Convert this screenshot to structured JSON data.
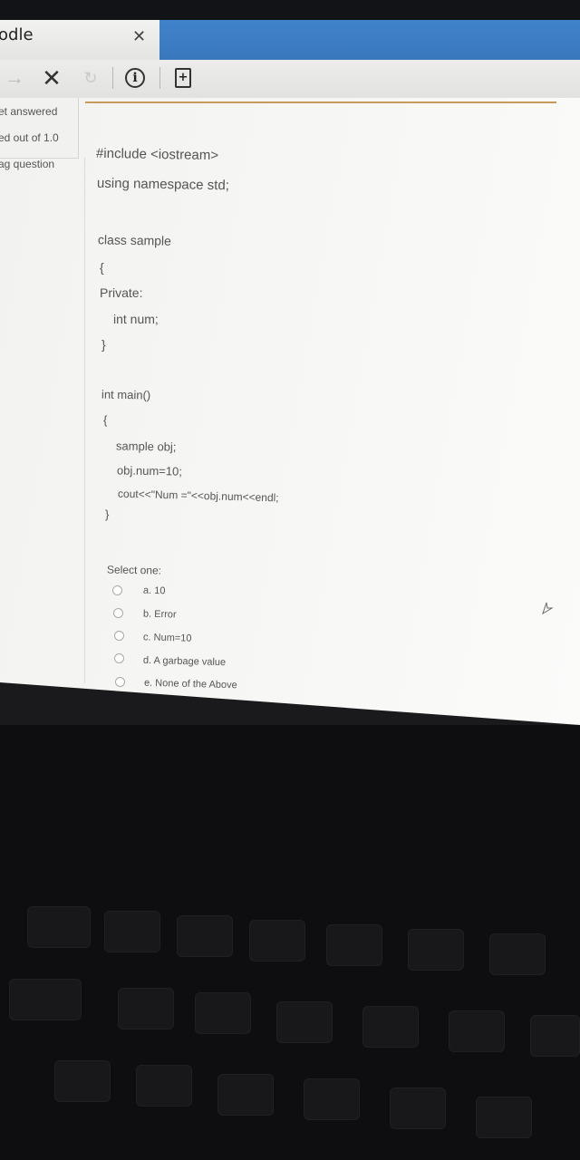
{
  "browser": {
    "tab_title": "odle",
    "tab_close_icon": "close-icon",
    "nav": {
      "forward_icon": "arrow-right-icon",
      "stop_icon": "close-icon",
      "refresh_icon": "refresh-icon",
      "info_icon": "info-icon",
      "page_icon": "page-add-icon"
    }
  },
  "sidebar": {
    "lines": [
      "et answered",
      "ed out of 1.0",
      "ag question"
    ]
  },
  "question": {
    "code_lines": [
      "#include <iostream>",
      "using namespace std;",
      "class sample",
      "{",
      "Private:",
      "int num;",
      "}",
      "int main()",
      "{",
      "sample obj;",
      "obj.num=10;",
      "cout<<\"Num =\"<<obj.num<<endl;",
      "}"
    ],
    "select_label": "Select one:",
    "options": [
      "a. 10",
      "b. Error",
      "c. Num=10",
      "d. A garbage value",
      "e. None of the Above"
    ]
  },
  "colors": {
    "tab_strip": "#3a78bd",
    "accent_rule": "#c79a58"
  }
}
